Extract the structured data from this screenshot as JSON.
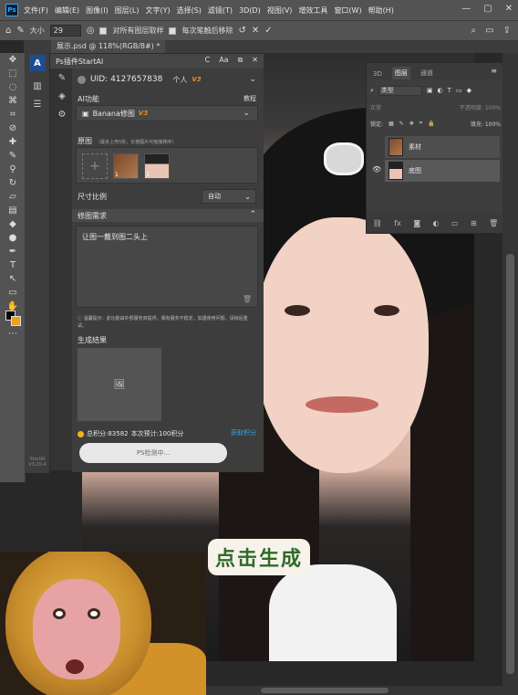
{
  "app": {
    "logo": "Ps"
  },
  "menu": [
    "文件(F)",
    "编辑(E)",
    "图像(I)",
    "图层(L)",
    "文字(Y)",
    "选择(S)",
    "滤镜(T)",
    "3D(D)",
    "视图(V)",
    "增效工具",
    "窗口(W)",
    "帮助(H)"
  ],
  "window_controls": {
    "minimize": "—",
    "maximize": "▢",
    "close": "✕"
  },
  "options": {
    "size_label": "大小",
    "size_value": "29",
    "sample_all_layers": "对所有图层取样",
    "erase_after_stroke": "每次笔触后移除"
  },
  "document_tab": "展示.psd @ 118%(RGB/8#) *",
  "plugin": {
    "strip_logo": "A",
    "strip_version": "StartAI V3.20.4",
    "title": "Ps插件StartAI",
    "header_icons": [
      "C",
      "Aa",
      "⧉",
      "✕"
    ],
    "uid": "UID: 4127657838",
    "account_type": "个人",
    "vtag": "V3",
    "ai_label": "AI功能",
    "help": "教程",
    "ai_function": "Banana修图",
    "original_label": "原图",
    "original_hint": "（最多上传5张，长按图片可拖拽排序）",
    "thumb_nums": [
      "1",
      "2"
    ],
    "size_label": "尺寸比例",
    "size_value": "自动",
    "request_label": "修图需求",
    "request_text": "让图一戴到图二头上",
    "warning": "温馨提示：此功能由外部服务商提供，偶有服务不稳定，如遇使用问题，请稍后重试。",
    "result_label": "生成结果",
    "points": "总积分:83582",
    "estimate": "本次预计:100积分",
    "get_points": "获取积分",
    "detect_button": "PS检测中..."
  },
  "layers_panel": {
    "tabs": [
      "3D",
      "图层",
      "通道"
    ],
    "filter": "类型",
    "blend_mode": "正常",
    "opacity_label": "不透明度:",
    "opacity_value": "100%",
    "lock_label": "锁定:",
    "fill_label": "填充:",
    "fill_value": "100%",
    "layers": [
      {
        "name": "素材",
        "visible": false
      },
      {
        "name": "底图",
        "visible": true
      }
    ],
    "bottom_icons": [
      "link-icon",
      "fx-icon",
      "mask-icon",
      "adjustment-icon",
      "group-icon",
      "new-layer-icon",
      "trash-icon"
    ]
  },
  "canvas": {
    "caption": "点击生成"
  },
  "colors": {
    "accent_blue": "#31a8ff",
    "version_orange": "#f08a24",
    "link_blue": "#33a1e6",
    "caption_green": "#2f6b2a",
    "bg_swatch": "#e9a21c"
  }
}
